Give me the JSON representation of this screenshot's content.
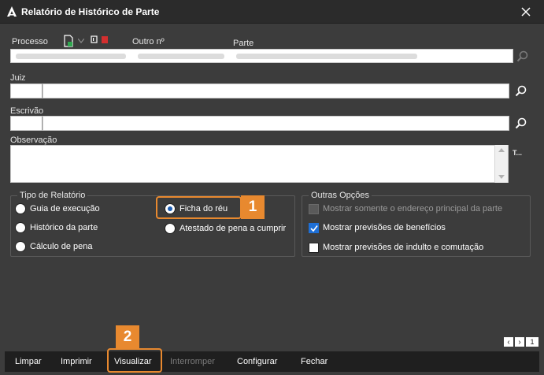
{
  "window": {
    "title": "Relatório de Histórico de Parte",
    "close_label": "✕"
  },
  "labels": {
    "processo": "Processo",
    "outro_n": "Outro nº",
    "parte": "Parte",
    "juiz": "Juiz",
    "escrivao": "Escrivão",
    "observacao": "Observação",
    "side_t": "T..."
  },
  "fields": {
    "processo": "",
    "outro_n": "",
    "parte": "",
    "juiz_code": "",
    "juiz_name": "",
    "escrivao_code": "",
    "escrivao_name": "",
    "observacao": ""
  },
  "tipo_relatorio": {
    "title": "Tipo de Relatório",
    "options": [
      {
        "label": "Guia de execução",
        "selected": false
      },
      {
        "label": "Histórico da parte",
        "selected": false
      },
      {
        "label": "Cálculo de pena",
        "selected": false
      },
      {
        "label": "Ficha do réu",
        "selected": true
      },
      {
        "label": "Atestado de pena a cumprir",
        "selected": false
      }
    ]
  },
  "outras_opcoes": {
    "title": "Outras Opções",
    "options": [
      {
        "label": "Mostrar somente o endereço principal da parte",
        "checked": false,
        "disabled": true
      },
      {
        "label": "Mostrar previsões de benefícios",
        "checked": true,
        "disabled": false
      },
      {
        "label": "Mostrar previsões de indulto e comutação",
        "checked": false,
        "disabled": false
      }
    ]
  },
  "callouts": {
    "one": "1",
    "two": "2"
  },
  "pager": {
    "prev": "‹",
    "next": "›",
    "page": "1"
  },
  "toolbar": {
    "limpar": "Limpar",
    "imprimir": "Imprimir",
    "visualizar": "Visualizar",
    "interromper": "Interromper",
    "configurar": "Configurar",
    "fechar": "Fechar"
  },
  "colors": {
    "accent": "#e8892f",
    "check": "#1e6fd6",
    "background": "#3c3c3c"
  }
}
